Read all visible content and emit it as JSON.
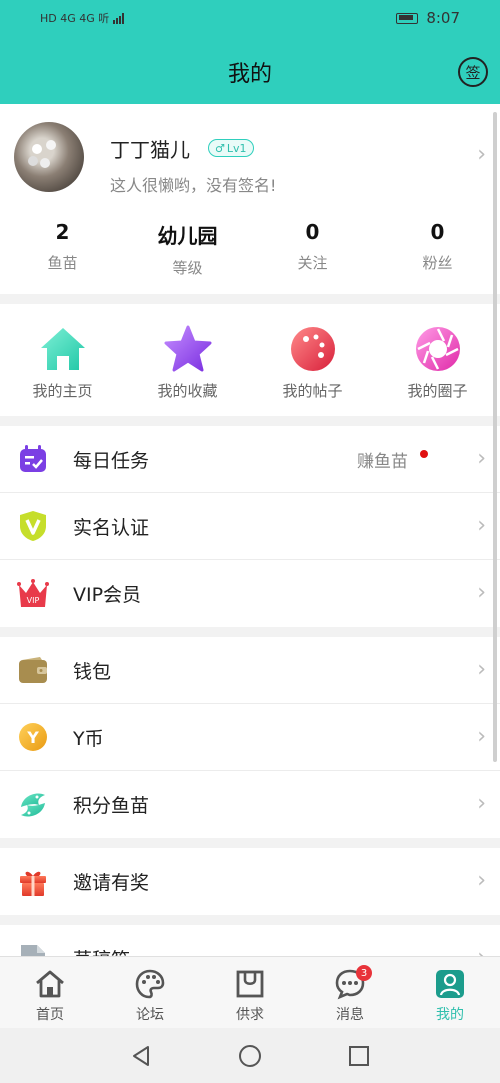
{
  "status_bar": {
    "left": "HD 4G 4G 听",
    "time": "8:07"
  },
  "header": {
    "title": "我的",
    "sign_label": "签",
    "color": "#2fcfbd"
  },
  "profile": {
    "name": "丁丁猫儿",
    "gender_symbol": "♂",
    "level": "Lv1",
    "bio": "这人很懒哟，没有签名!",
    "stats": [
      {
        "value": "2",
        "label": "鱼苗"
      },
      {
        "value": "幼儿园",
        "label": "等级"
      },
      {
        "value": "0",
        "label": "关注"
      },
      {
        "value": "0",
        "label": "粉丝"
      }
    ]
  },
  "quick_links": [
    {
      "label": "我的主页",
      "icon": "home-icon"
    },
    {
      "label": "我的收藏",
      "icon": "star-icon"
    },
    {
      "label": "我的帖子",
      "icon": "palette-icon"
    },
    {
      "label": "我的圈子",
      "icon": "aperture-icon"
    }
  ],
  "menu_groups": [
    [
      {
        "label": "每日任务",
        "extra": "赚鱼苗",
        "icon": "calendar-check-icon"
      },
      {
        "label": "实名认证",
        "icon": "verified-shield-icon"
      },
      {
        "label": "VIP会员",
        "icon": "vip-crown-icon",
        "icon_text": "VIP"
      }
    ],
    [
      {
        "label": "钱包",
        "icon": "wallet-icon"
      },
      {
        "label": "Y币",
        "icon": "y-coin-icon",
        "icon_text": "Y"
      },
      {
        "label": "积分鱼苗",
        "icon": "fish-icon"
      }
    ],
    [
      {
        "label": "邀请有奖",
        "icon": "gift-icon"
      }
    ],
    [
      {
        "label": "草稿箱",
        "icon": "draft-document-icon"
      }
    ]
  ],
  "bottom_nav": [
    {
      "label": "首页",
      "icon": "home-outline-icon"
    },
    {
      "label": "论坛",
      "icon": "palette-outline-icon"
    },
    {
      "label": "供求",
      "icon": "shopping-bag-icon"
    },
    {
      "label": "消息",
      "icon": "chat-bubble-icon",
      "badge": "3"
    },
    {
      "label": "我的",
      "icon": "user-profile-icon",
      "active": true
    }
  ]
}
